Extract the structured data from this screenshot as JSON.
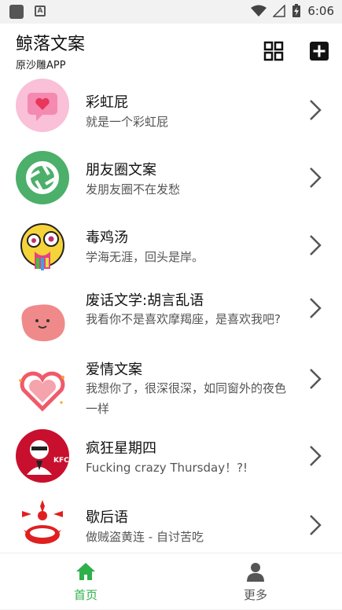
{
  "status_bar": {
    "time": "6:06"
  },
  "header": {
    "title": "鲸落文案",
    "subtitle": "原沙雕APP"
  },
  "list": [
    {
      "title": "彩虹屁",
      "desc": "就是一个彩虹屁",
      "icon": "heart-chat-icon",
      "color": "#f7b3cf"
    },
    {
      "title": "朋友圈文案",
      "desc": "发朋友圈不在发愁",
      "icon": "aperture-icon",
      "color": "#4caf6a"
    },
    {
      "title": "毒鸡汤",
      "desc": "学海无涯，回头是岸。",
      "icon": "crazy-face-icon",
      "color": "#f5d33a"
    },
    {
      "title": "废话文学:胡言乱语",
      "desc": "我看你不是喜欢摩羯座，是喜欢我吧?",
      "icon": "blob-face-icon",
      "color": "#f08a8a"
    },
    {
      "title": "爱情文案",
      "desc": "我想你了，很深很深，如同窗外的夜色一样",
      "icon": "heart-outline-icon",
      "color": "#f05a6a"
    },
    {
      "title": "疯狂星期四",
      "desc": "Fucking crazy Thursday！?!",
      "icon": "kfc-colonel-icon",
      "color": "#c8102e"
    },
    {
      "title": "歇后语",
      "desc": "做贼盗黄连 - 自讨苦吃",
      "icon": "clown-face-icon",
      "color": "#e02020"
    }
  ],
  "tabs": [
    {
      "label": "首页",
      "icon": "home-icon",
      "active": true
    },
    {
      "label": "更多",
      "icon": "user-icon",
      "active": false
    }
  ],
  "colors": {
    "accent": "#2fb04a",
    "header_bg": "#ffffff",
    "page_bg": "#f2f2f2"
  }
}
